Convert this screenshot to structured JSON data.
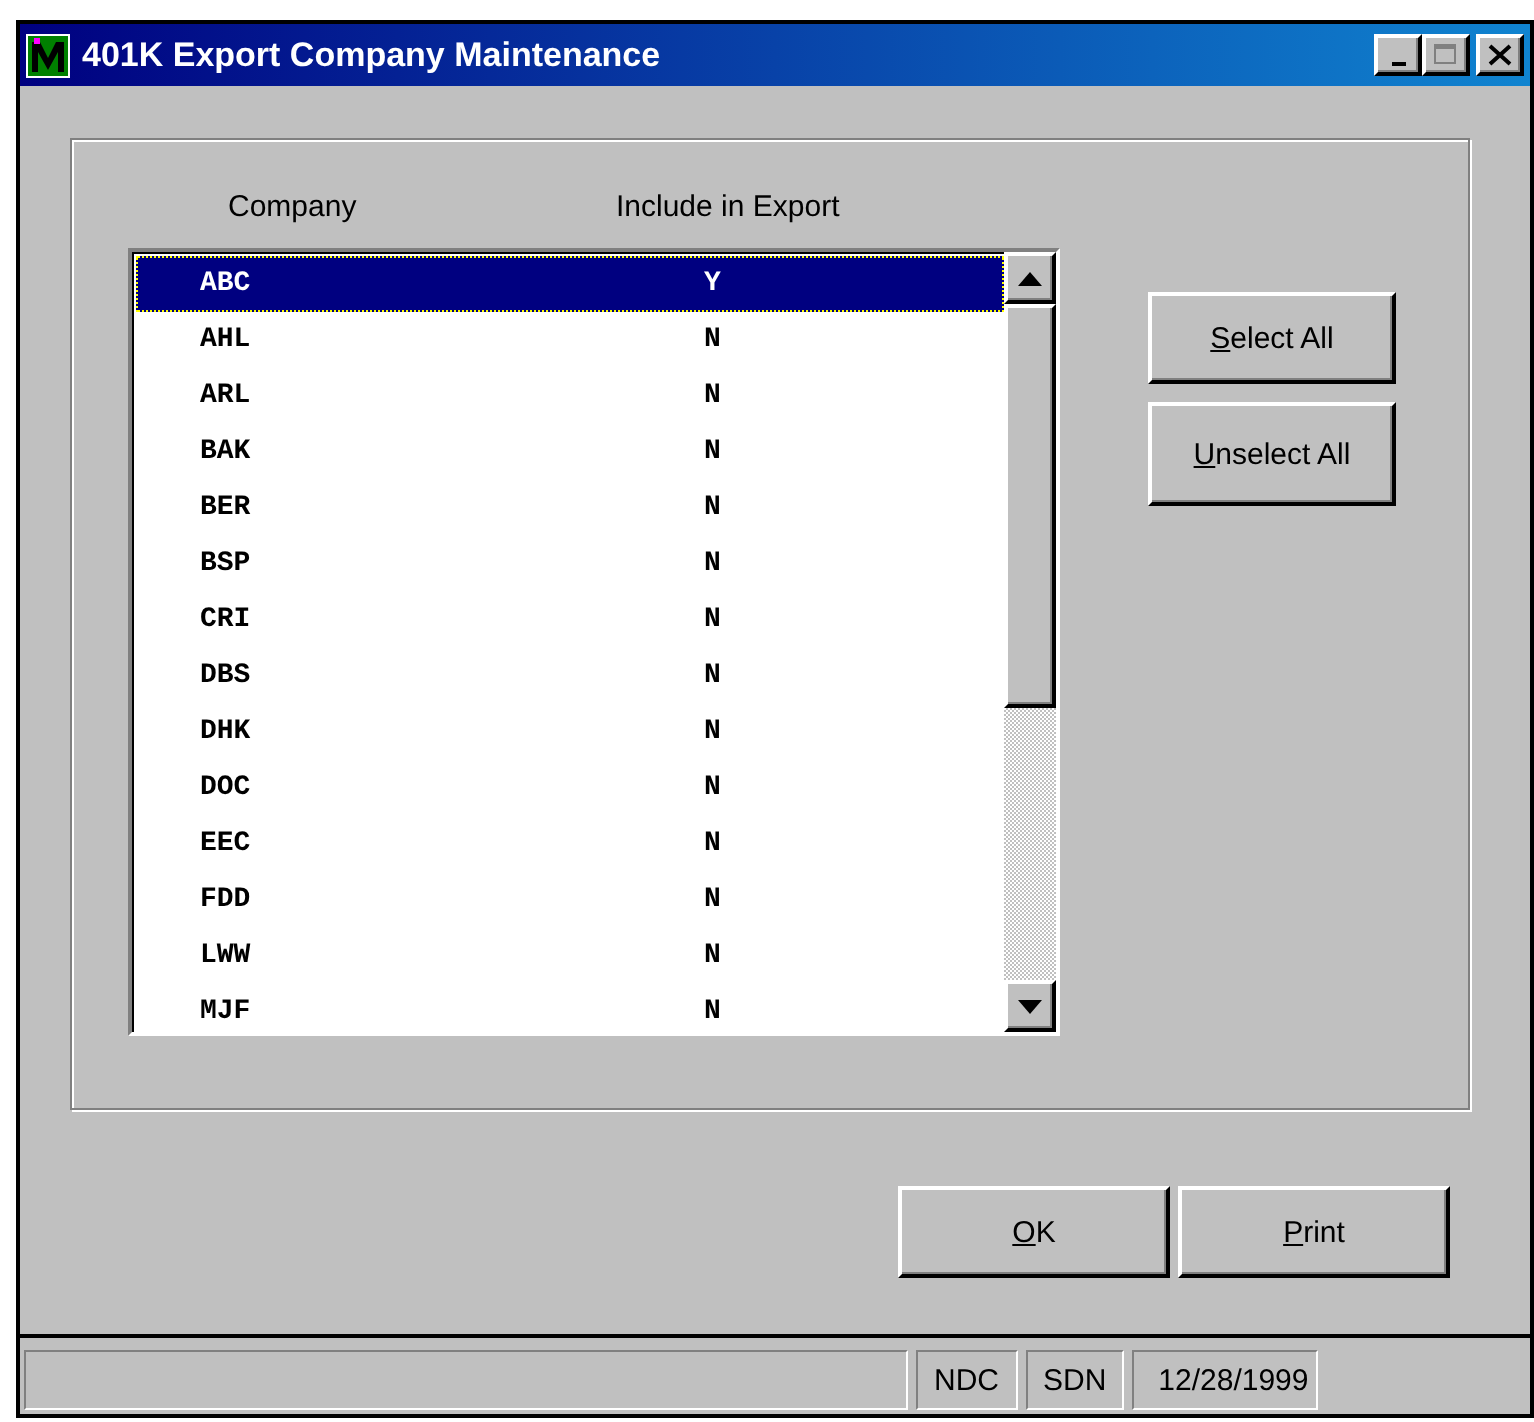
{
  "window": {
    "title": "401K Export Company Maintenance"
  },
  "list": {
    "columns": [
      "Company",
      "Include in Export"
    ],
    "rows": [
      {
        "company": "ABC",
        "include": "Y",
        "selected": true
      },
      {
        "company": "AHL",
        "include": "N",
        "selected": false
      },
      {
        "company": "ARL",
        "include": "N",
        "selected": false
      },
      {
        "company": "BAK",
        "include": "N",
        "selected": false
      },
      {
        "company": "BER",
        "include": "N",
        "selected": false
      },
      {
        "company": "BSP",
        "include": "N",
        "selected": false
      },
      {
        "company": "CRI",
        "include": "N",
        "selected": false
      },
      {
        "company": "DBS",
        "include": "N",
        "selected": false
      },
      {
        "company": "DHK",
        "include": "N",
        "selected": false
      },
      {
        "company": "DOC",
        "include": "N",
        "selected": false
      },
      {
        "company": "EEC",
        "include": "N",
        "selected": false
      },
      {
        "company": "FDD",
        "include": "N",
        "selected": false
      },
      {
        "company": "LWW",
        "include": "N",
        "selected": false
      },
      {
        "company": "MJF",
        "include": "N",
        "selected": false
      }
    ]
  },
  "side_buttons": [
    {
      "label": "Select All",
      "mnemonic": true
    },
    {
      "label": "Unselect All",
      "mnemonic": true
    }
  ],
  "bottom_buttons": [
    {
      "label": "OK",
      "mnemonic": true
    },
    {
      "label": "Print",
      "mnemonic": true
    }
  ],
  "status_bar": [
    "NDC",
    "SDN",
    "12/28/1999"
  ]
}
